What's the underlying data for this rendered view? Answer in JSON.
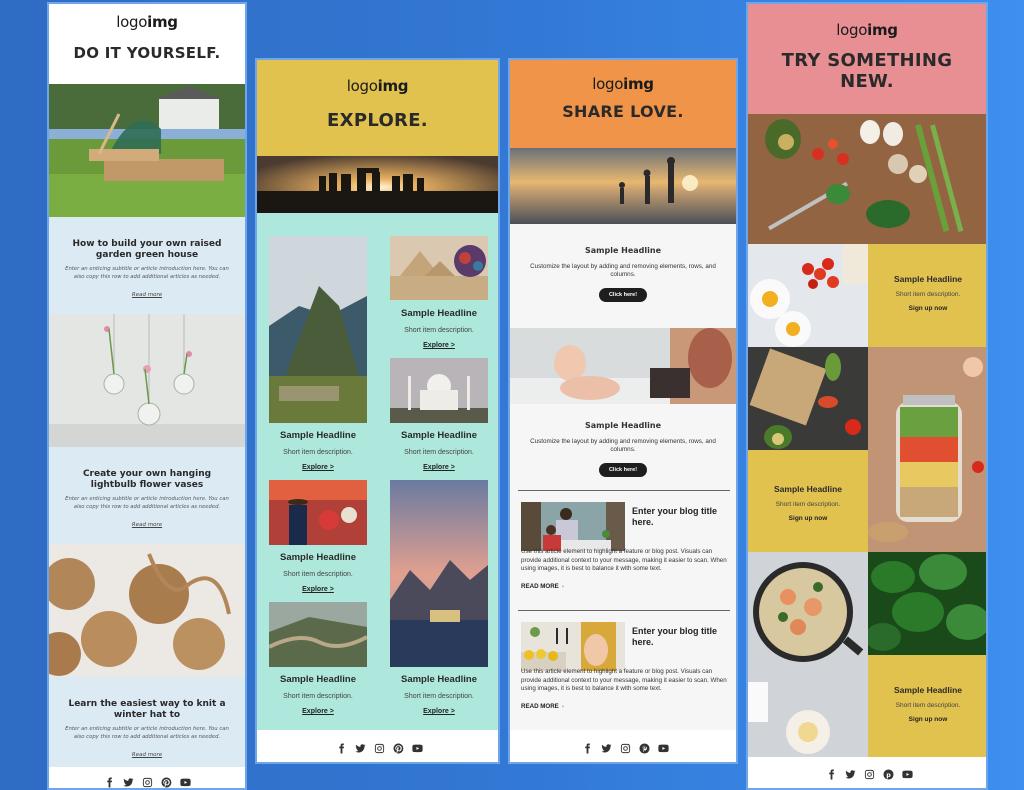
{
  "background": {
    "colors": [
      "#2f6cc4",
      "#3d8ff0"
    ]
  },
  "logo": {
    "light": "logo",
    "bold": "img"
  },
  "social_icons": [
    "facebook-icon",
    "twitter-icon",
    "instagram-icon",
    "pinterest-icon",
    "youtube-icon"
  ],
  "templates": [
    {
      "id": "diy",
      "header_color": "#ffffff",
      "title": "DO IT YOURSELF.",
      "articles": [
        {
          "image": "garden greenhouse photo",
          "title": "How to build your own raised garden green house",
          "subtitle": "Enter an enticing subtitle or article introduction here. You can also copy this row to add additional articles as needed.",
          "link": "Read more"
        },
        {
          "image": "hanging lightbulb vases photo",
          "title": "Create your own hanging lightbulb flower vases",
          "subtitle": "Enter an enticing subtitle or article introduction here. You can also copy this row to add additional articles as needed.",
          "link": "Read more"
        },
        {
          "image": "yarn balls photo",
          "title": "Learn the easiest way to knit a winter hat to",
          "subtitle": "Enter an enticing subtitle or article introduction here. You can also copy this row to add additional articles as needed.",
          "link": "Read more"
        }
      ],
      "panel_color": "#dceaf4"
    },
    {
      "id": "explore",
      "header_color": "#e2c24f",
      "body_color": "#aee8dd",
      "title": "EXPLORE.",
      "hero_image": "stonehenge sunset photo",
      "items": [
        {
          "image": "machu picchu photo",
          "headline": "Sample Headline",
          "description": "Short item description.",
          "link": "Explore >"
        },
        {
          "image": "pyramids photo",
          "headline": "Sample Headline",
          "description": "Short item description.",
          "link": "Explore >"
        },
        {
          "image": "taj mahal photo",
          "headline": "Sample Headline",
          "description": "Short item description.",
          "link": "Explore >"
        },
        {
          "image": "festival photo",
          "headline": "Sample Headline",
          "description": "Short item description.",
          "link": "Explore >"
        },
        {
          "image": "mountain lake photo",
          "headline": "Sample Headline",
          "description": "Short item description.",
          "link": "Explore >"
        },
        {
          "image": "great wall photo",
          "headline": "Sample Headline",
          "description": "Short item description.",
          "link": "Explore >"
        }
      ]
    },
    {
      "id": "share-love",
      "header_color": "#ef9448",
      "title": "SHARE LOVE.",
      "hero_image": "family beach sunset photo",
      "blocks": [
        {
          "headline": "Sample Headline",
          "description": "Customize the layout by adding and removing elements, rows, and columns.",
          "button": "Click here!"
        },
        {
          "image": "baby photo",
          "headline": "Sample Headline",
          "description": "Customize the layout by adding and removing elements, rows, and columns.",
          "button": "Click here!"
        }
      ],
      "blogs": [
        {
          "image": "kitchen sink photo",
          "title": "Enter your blog title here.",
          "body": "Use this article element to highlight a feature or blog post. Visuals can provide additional context to your message, making it easier to scan. When using images, it is best to balance it with some text.",
          "link": "READ MORE",
          "chevron": "›"
        },
        {
          "image": "baby lemons photo",
          "title": "Enter your blog title here.",
          "body": "Use this article element to highlight a feature or blog post. Visuals can provide additional context to your message, making it easier to scan. When using images, it is best to balance it with some text.",
          "link": "READ MORE",
          "chevron": "›"
        }
      ]
    },
    {
      "id": "try-new",
      "header_color": "#e88f94",
      "tile_color": "#e2c24f",
      "title": "TRY SOMETHING NEW.",
      "hero_image": "vegetables cutting board photo",
      "tiles": [
        {
          "headline": "Sample Headline",
          "description": "Short item description.",
          "link": "Sign up now"
        },
        {
          "headline": "Sample Headline",
          "description": "Short item description.",
          "link": "Sign up now"
        },
        {
          "headline": "Sample Headline",
          "description": "Short item description.",
          "link": "Sign up now"
        }
      ]
    }
  ]
}
